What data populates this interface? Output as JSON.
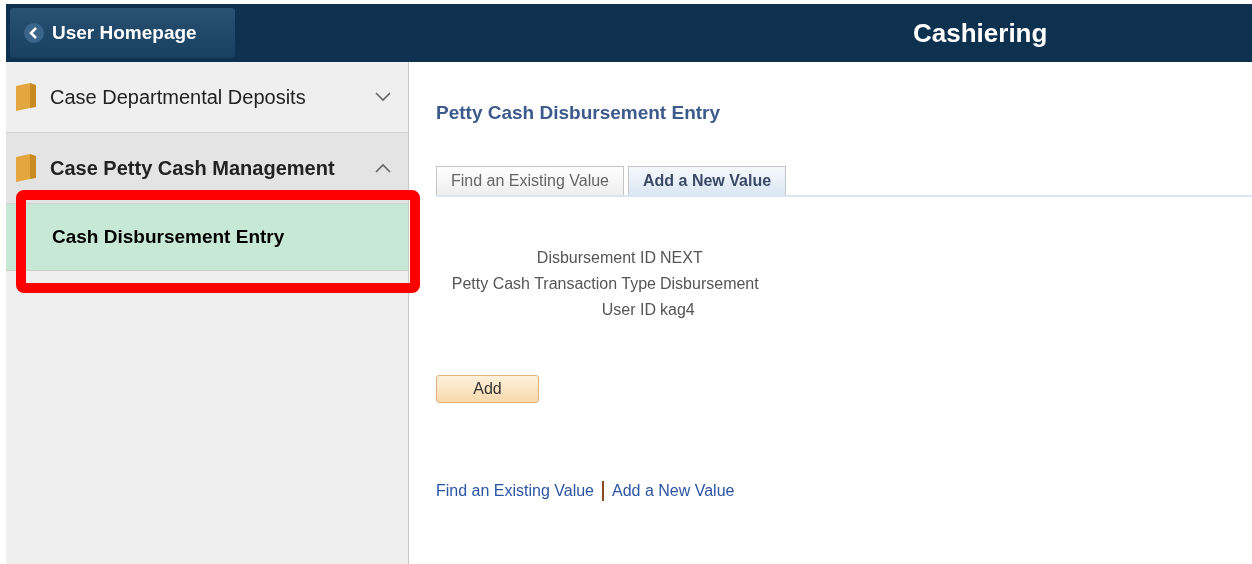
{
  "header": {
    "back_button": "User Homepage",
    "title": "Cashiering"
  },
  "sidebar": {
    "items": [
      {
        "label": "Case Departmental Deposits",
        "expanded": false
      },
      {
        "label": "Case Petty Cash Management",
        "expanded": true,
        "children": [
          {
            "label": "Cash Disbursement Entry",
            "selected": true
          }
        ]
      }
    ],
    "highlighted": true
  },
  "page_title": "Petty Cash Disbursement Entry",
  "tabs": [
    {
      "label": "Find an Existing Value",
      "selected": false
    },
    {
      "label": "Add a New Value",
      "selected": true
    }
  ],
  "fields": [
    {
      "label": "Disbursement ID",
      "value": "NEXT"
    },
    {
      "label": "Petty Cash Transaction Type",
      "value": "Disbursement"
    },
    {
      "label": "User ID",
      "value": "kag4"
    }
  ],
  "add_button": "Add",
  "footer_links": [
    "Find an Existing Value",
    "Add a New Value"
  ]
}
